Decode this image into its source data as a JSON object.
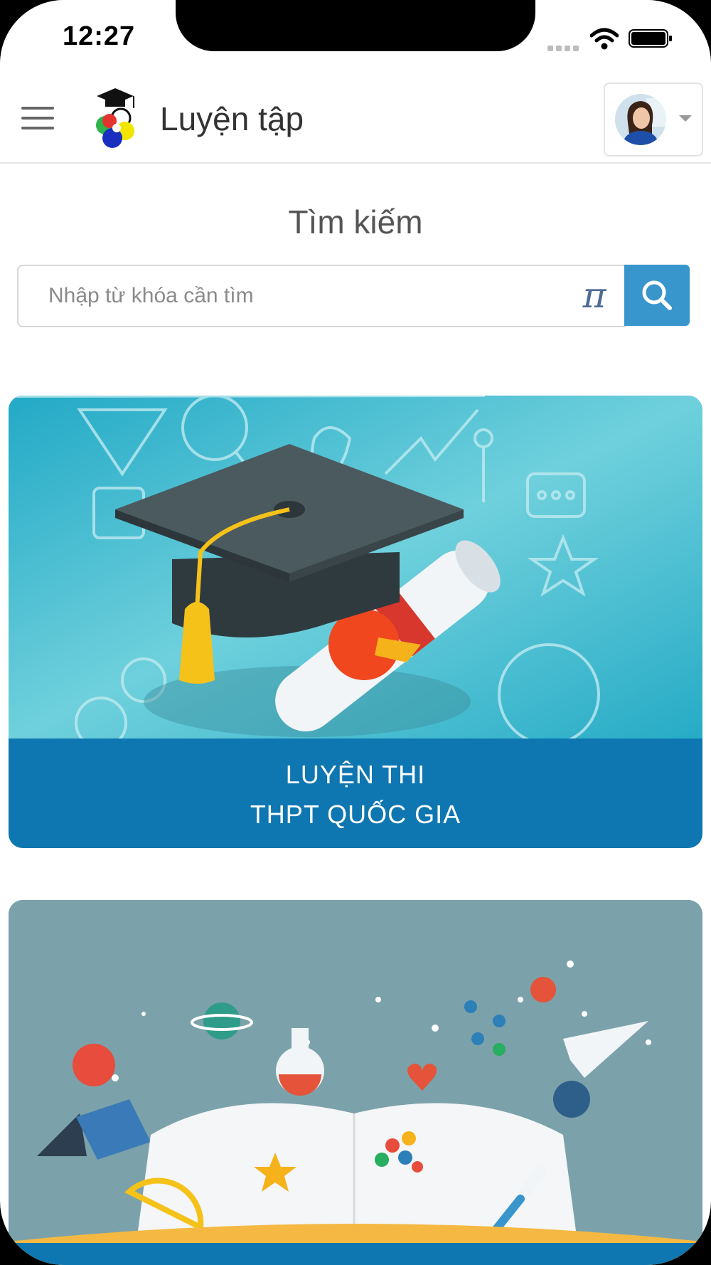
{
  "status_bar": {
    "time": "12:27"
  },
  "header": {
    "title": "Luyện tập"
  },
  "search": {
    "title": "Tìm kiếm",
    "placeholder": "Nhập từ khóa cần tìm",
    "math_symbol": "π"
  },
  "cards": [
    {
      "line1": "LUYỆN THI",
      "line2": "THPT QUỐC GIA"
    }
  ],
  "colors": {
    "accent": "#3996cc",
    "caption_bg": "#0e76b0",
    "card1_bg": "#4ec0d2",
    "card2_bg": "#7ba2aa"
  }
}
